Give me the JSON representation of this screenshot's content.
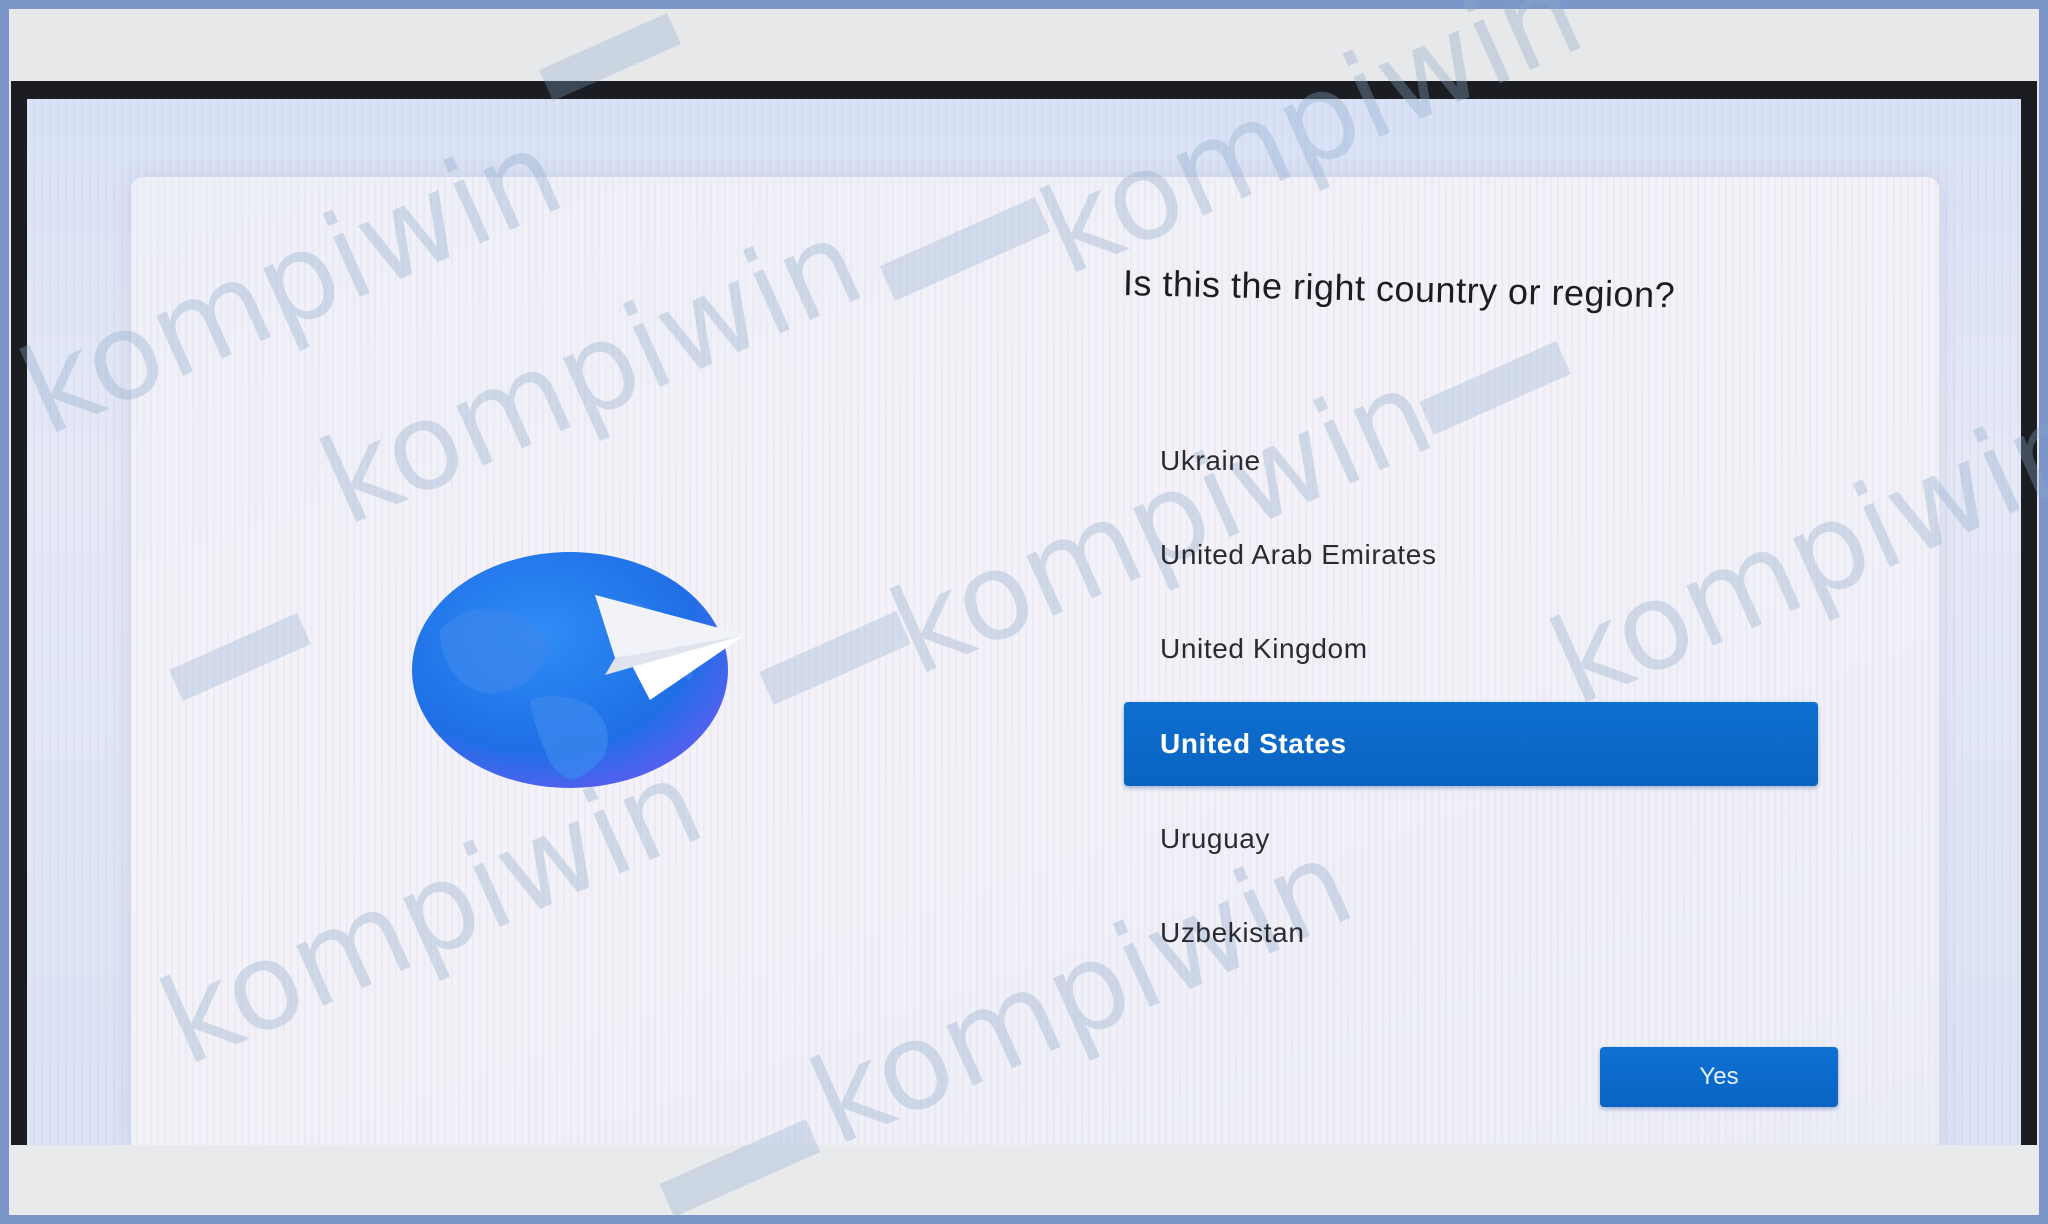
{
  "setup": {
    "question": "Is this the right country or region?",
    "countries": [
      {
        "label": "Ukraine",
        "selected": false
      },
      {
        "label": "United Arab Emirates",
        "selected": false
      },
      {
        "label": "United Kingdom",
        "selected": false
      },
      {
        "label": "United States",
        "selected": true
      },
      {
        "label": "Uruguay",
        "selected": false
      },
      {
        "label": "Uzbekistan",
        "selected": false
      }
    ],
    "yes_label": "Yes"
  },
  "illustration": {
    "icon": "globe-with-paper-plane-icon"
  },
  "watermark": {
    "text": "kompiwin"
  },
  "colors": {
    "accent": "#0a67c8",
    "globe": "#1a73e8"
  }
}
